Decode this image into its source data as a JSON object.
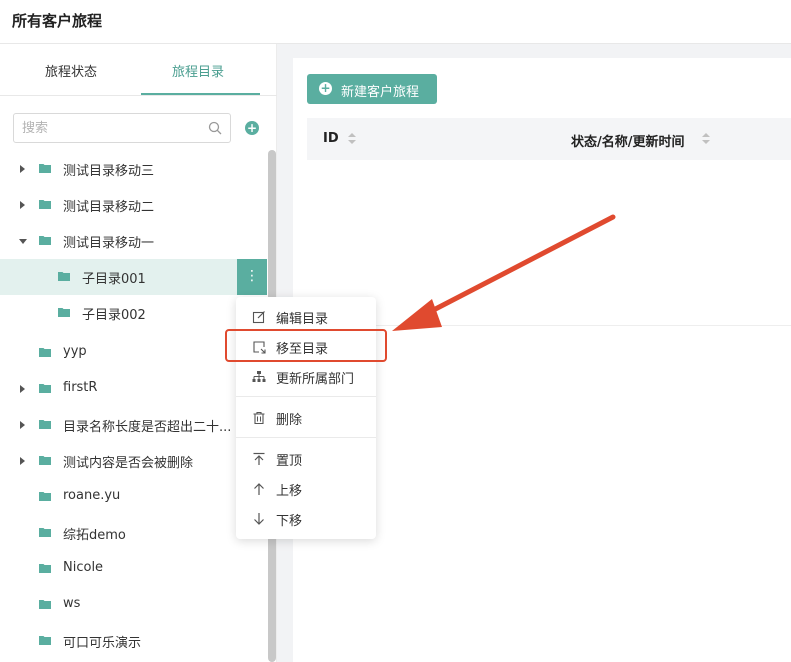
{
  "header": {
    "title": "所有客户旅程"
  },
  "sidebar": {
    "tabs": [
      {
        "label": "旅程状态"
      },
      {
        "label": "旅程目录"
      }
    ],
    "search": {
      "placeholder": "搜索"
    },
    "tree": [
      {
        "label": "测试目录移动三",
        "caret": "right",
        "level": 0
      },
      {
        "label": "测试目录移动二",
        "caret": "right",
        "level": 0
      },
      {
        "label": "测试目录移动一",
        "caret": "down",
        "level": 0
      },
      {
        "label": "子目录001",
        "caret": "none",
        "level": 1,
        "selected": true
      },
      {
        "label": "子目录002",
        "caret": "none",
        "level": 1
      },
      {
        "label": "yyp",
        "caret": "none",
        "level": 0
      },
      {
        "label": "firstR",
        "caret": "right",
        "level": 0
      },
      {
        "label": "目录名称长度是否超出二十...",
        "caret": "right",
        "level": 0
      },
      {
        "label": "测试内容是否会被删除",
        "caret": "right",
        "level": 0
      },
      {
        "label": "roane.yu",
        "caret": "none",
        "level": 0
      },
      {
        "label": "综拓demo",
        "caret": "none",
        "level": 0
      },
      {
        "label": "Nicole",
        "caret": "none",
        "level": 0
      },
      {
        "label": "ws",
        "caret": "none",
        "level": 0
      },
      {
        "label": "可口可乐演示",
        "caret": "none",
        "level": 0
      }
    ],
    "more_label": "⋮"
  },
  "main": {
    "new_button": "新建客户旅程",
    "columns": [
      {
        "label": "ID"
      },
      {
        "label": "状态/名称/更新时间"
      }
    ]
  },
  "context_menu": {
    "items": [
      {
        "label": "编辑目录",
        "icon": "edit-icon"
      },
      {
        "label": "移至目录",
        "icon": "move-icon"
      },
      {
        "label": "更新所属部门",
        "icon": "org-icon"
      },
      {
        "label": "删除",
        "icon": "trash-icon"
      },
      {
        "label": "置顶",
        "icon": "pin-top-icon"
      },
      {
        "label": "上移",
        "icon": "arrow-up-icon"
      },
      {
        "label": "下移",
        "icon": "arrow-down-icon"
      }
    ]
  },
  "colors": {
    "accent": "#5aaea0",
    "annotation": "#e04a2f"
  }
}
